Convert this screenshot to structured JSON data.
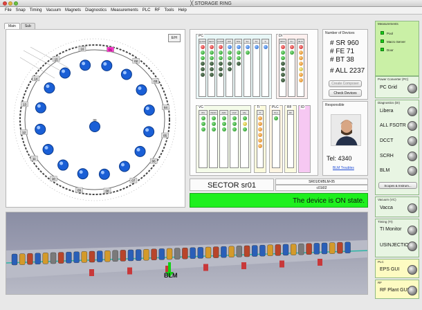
{
  "window": {
    "title": "STORAGE RING"
  },
  "menu": [
    "File",
    "Snap",
    "Timing",
    "Vacuum",
    "Magnets",
    "Diagnostics",
    "Measurements",
    "PLC",
    "RF",
    "Tools",
    "Help"
  ],
  "tabs": [
    "Main",
    "Sub"
  ],
  "ring": {
    "button": "E/H",
    "sectors": [
      "16",
      "01",
      "02",
      "03",
      "04",
      "05",
      "06",
      "07",
      "08",
      "09",
      "10",
      "11",
      "12",
      "13",
      "14",
      "15",
      "00"
    ],
    "highlight_sector": "01"
  },
  "groups": {
    "pc": "PC",
    "di": "DI",
    "vc": "VC",
    "ti": "TI",
    "plc": "PLC",
    "rf": "RF",
    "id": "ID"
  },
  "pc_cols": [
    "QUAD",
    "SEXT",
    "CORR",
    "DIP",
    "SKE",
    "SH",
    "SV",
    "S"
  ],
  "di_cols": [
    "BPM",
    "FH",
    "BLM"
  ],
  "vc_cols": [
    "IPU",
    "PENN",
    "ARD",
    "VGP",
    "VAL"
  ],
  "ti_cols": [
    "TI"
  ],
  "plc_cols": [
    "PLC"
  ],
  "rf_cols": [
    "RF"
  ],
  "number_of_devices": {
    "title": "Number of Devices",
    "lines": [
      "# SR  960",
      "# FE   71",
      "# BT   38",
      "# ALL  2237"
    ],
    "btn1": "Create Composer",
    "btn2": "Check Devices"
  },
  "responsible": {
    "title": "Responsible",
    "tel": "Tel: 4340",
    "link": "BLM Troubles"
  },
  "sector": {
    "name": "SECTOR sr01",
    "path": "SR01/DI/BLM-05",
    "cell": "c01t02"
  },
  "state": "The device is ON state.",
  "tunnel": {
    "label": "BLM"
  },
  "right": {
    "measurements": {
      "title": "Measurements",
      "items": [
        "Pool",
        "Macro Server",
        "Door"
      ]
    },
    "pc": {
      "title": "Power Converter (PC)",
      "items": [
        "PC Grid"
      ]
    },
    "di": {
      "title": "Diagnostics (DI)",
      "items": [
        "Libera",
        "ALL FSOTR",
        "DCCT",
        "SCRH",
        "BLM"
      ],
      "btn": "Scopes & Instrum..."
    },
    "vc": {
      "title": "Vacuum (VC)",
      "items": [
        "Vacca"
      ]
    },
    "ti": {
      "title": "Timing (TI)",
      "items": [
        "TI Monitor",
        "USINJECTION"
      ]
    },
    "plc": {
      "title": "PLC",
      "items": [
        "EPS GUI"
      ]
    },
    "rf": {
      "title": "RF",
      "items": [
        "RF Plant GUI"
      ]
    }
  },
  "colors": {
    "state": "#1ef01e",
    "right_bg": "#e8f5e3",
    "right_top": "#caf0a6",
    "title_accent": "#ff33cc"
  }
}
